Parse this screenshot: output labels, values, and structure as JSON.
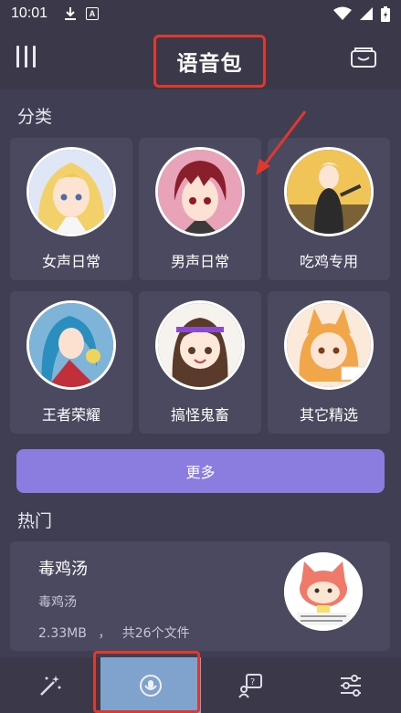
{
  "status_bar": {
    "time": "10:01",
    "icons": [
      "download-icon",
      "a-badge-icon",
      "wifi-icon",
      "signal-icon",
      "battery-icon"
    ],
    "badge_letter": "A"
  },
  "header": {
    "title": "语音包",
    "left_icon": "menu-icon",
    "right_icon": "folder-icon"
  },
  "categories": {
    "title": "分类",
    "items": [
      {
        "label": "女声日常",
        "avatar": "blonde-girl-avatar"
      },
      {
        "label": "男声日常",
        "avatar": "red-hair-boy-avatar"
      },
      {
        "label": "吃鸡专用",
        "avatar": "pubg-character-avatar"
      },
      {
        "label": "王者荣耀",
        "avatar": "honor-of-kings-avatar"
      },
      {
        "label": "搞怪鬼畜",
        "avatar": "funny-girl-avatar"
      },
      {
        "label": "其它精选",
        "avatar": "fox-girl-avatar"
      }
    ],
    "more_label": "更多"
  },
  "hot": {
    "title": "热门",
    "items": [
      {
        "name": "毒鸡汤",
        "subtitle": "毒鸡汤",
        "size": "2.33MB",
        "separator": "，",
        "files": "共26个文件",
        "avatar": "cat-cartoon-avatar"
      }
    ]
  },
  "bottom_nav": {
    "items": [
      {
        "icon": "magic-wand-icon",
        "active": false
      },
      {
        "icon": "voice-pack-icon",
        "active": true
      },
      {
        "icon": "help-icon",
        "active": false
      },
      {
        "icon": "settings-sliders-icon",
        "active": false
      }
    ]
  },
  "colors": {
    "background": "#403e52",
    "card": "#4b4960",
    "bar": "#3a3849",
    "accent": "#8b7de0",
    "highlight_outline": "#e0392b",
    "active_tab": "#7fa3cc"
  }
}
